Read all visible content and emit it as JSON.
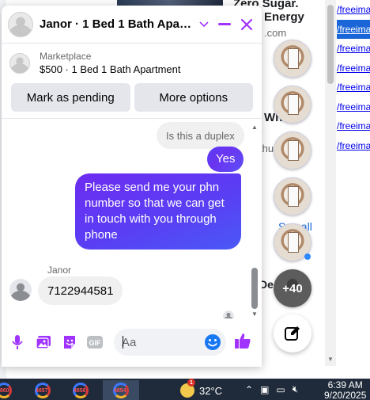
{
  "background": {
    "snippets": [
      "Zero Sugar.",
      "Energy",
      ".com",
      "Wh",
      "thu",
      "See all",
      "De"
    ],
    "links": [
      "/freeima",
      "/freeima",
      "/freeima",
      "/freeima",
      "/freeima",
      "/freeima",
      "/freeima",
      "/freeima"
    ]
  },
  "chat_heads": {
    "more_count": "+40"
  },
  "chat": {
    "title": "Janor · 1 Bed 1 Bath Apart...",
    "listing": {
      "source": "Marketplace",
      "name": "$500 · 1 Bed 1 Bath Apartment"
    },
    "actions": {
      "mark_pending": "Mark as pending",
      "more_options": "More options"
    },
    "messages": {
      "incoming_1": "Is this a duplex",
      "outgoing_1": "Yes",
      "outgoing_2": "Please send me your phn number so that we can get in touch with you through phone",
      "sender_name": "Janor",
      "incoming_2": "7122944581"
    },
    "composer": {
      "placeholder": "Aa"
    },
    "accent_color": "#a033ff",
    "bubble_color": "#5b3df5"
  },
  "taskbar": {
    "app_badges": [
      "4860",
      "4857",
      "4856",
      "4854"
    ],
    "weather_badge": "1",
    "temperature": "32°C",
    "time": "6:39 AM",
    "date": "9/20/2025"
  }
}
